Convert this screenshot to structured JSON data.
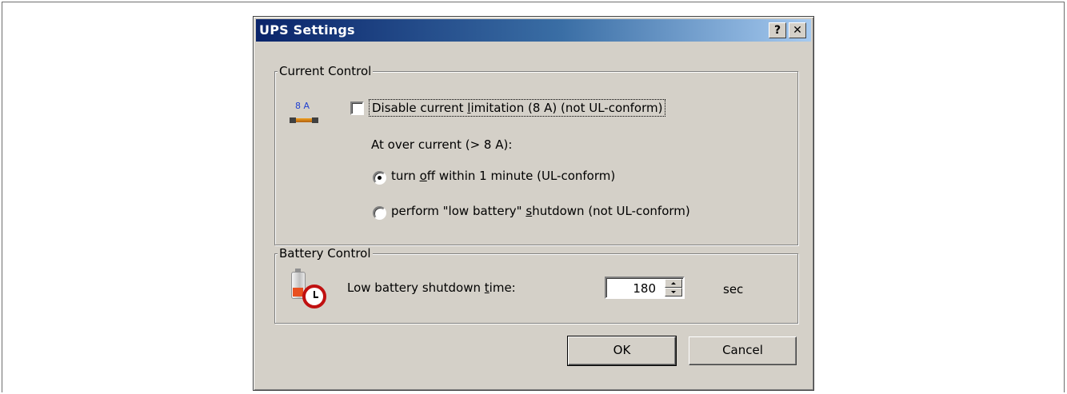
{
  "dialog": {
    "title": "UPS Settings",
    "help_label": "?",
    "close_label": "✕"
  },
  "current_control": {
    "legend": "Current Control",
    "icon_label": "8 A",
    "disable_limit": {
      "label_pre": "Disable current ",
      "label_mnemonic": "l",
      "label_post": "imitation (8 A) (not UL-conform)",
      "checked": false
    },
    "over_current_label": "At over current (> 8 A):",
    "options": [
      {
        "label_pre": "turn ",
        "label_mnemonic": "o",
        "label_post": "ff within 1 minute (UL-conform)",
        "selected": true
      },
      {
        "label_pre": "perform \"low battery\" ",
        "label_mnemonic": "s",
        "label_post": "hutdown (not UL-conform)",
        "selected": false
      }
    ]
  },
  "battery_control": {
    "legend": "Battery Control",
    "shutdown_label_pre": "Low battery shutdown ",
    "shutdown_label_mnemonic": "t",
    "shutdown_label_post": "ime:",
    "shutdown_value": "180",
    "unit": "sec"
  },
  "buttons": {
    "ok": "OK",
    "cancel": "Cancel"
  },
  "colors": {
    "title_gradient_start": "#0a246a",
    "title_gradient_end": "#a6caf0",
    "dialog_face": "#d4d0c8"
  }
}
